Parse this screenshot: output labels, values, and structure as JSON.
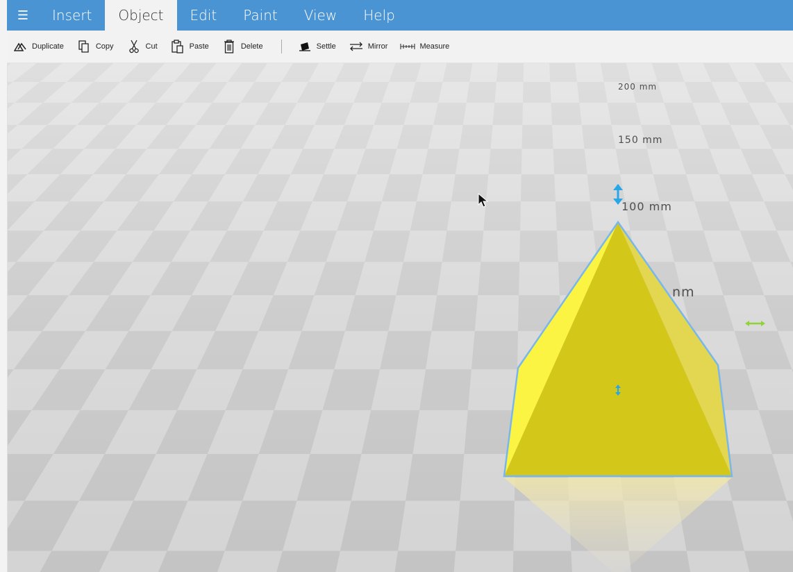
{
  "menu": {
    "hamburger_icon": "hamburger-icon",
    "tabs": [
      {
        "label": "Insert",
        "active": false
      },
      {
        "label": "Object",
        "active": true
      },
      {
        "label": "Edit",
        "active": false
      },
      {
        "label": "Paint",
        "active": false
      },
      {
        "label": "View",
        "active": false
      },
      {
        "label": "Help",
        "active": false
      }
    ]
  },
  "toolbar": {
    "duplicate": "Duplicate",
    "copy": "Copy",
    "cut": "Cut",
    "paste": "Paste",
    "delete": "Delete",
    "settle": "Settle",
    "mirror": "Mirror",
    "measure": "Measure"
  },
  "ruler": {
    "l200": "200 mm",
    "l150": "150 mm",
    "l100": "100 mm",
    "l50": "nm"
  },
  "colors": {
    "accent": "#4a94d3",
    "object": "#d6c81c",
    "object_light": "#fbf443",
    "selection": "#79b7ea",
    "handle_blue": "#29a6e8",
    "handle_green": "#8fd336"
  }
}
